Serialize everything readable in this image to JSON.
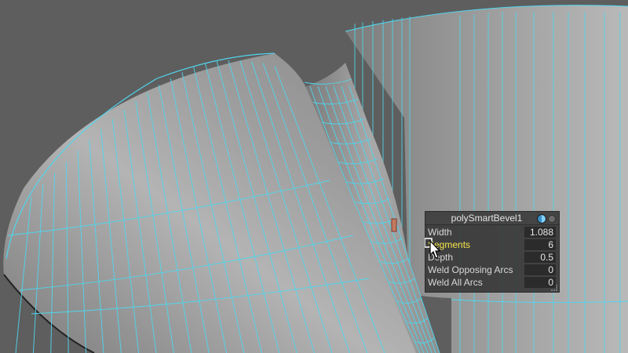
{
  "hud": {
    "title": "polySmartBevel1",
    "rows": [
      {
        "label": "Width",
        "value": "1.088"
      },
      {
        "label": "Segments",
        "value": "6"
      },
      {
        "label": "Depth",
        "value": "0.5"
      },
      {
        "label": "Weld Opposing Arcs",
        "value": "0"
      },
      {
        "label": "Weld All Arcs",
        "value": "0"
      }
    ]
  },
  "colors": {
    "background": "#5e5e5e",
    "wireframe": "#4fd6ee",
    "highlight_label": "#f2e54a",
    "hud_bg": "#3a3a3a"
  },
  "icons": [
    "bevel-node-icon",
    "close-icon",
    "mouse-cursor-icon",
    "resize-grip-icon"
  ]
}
